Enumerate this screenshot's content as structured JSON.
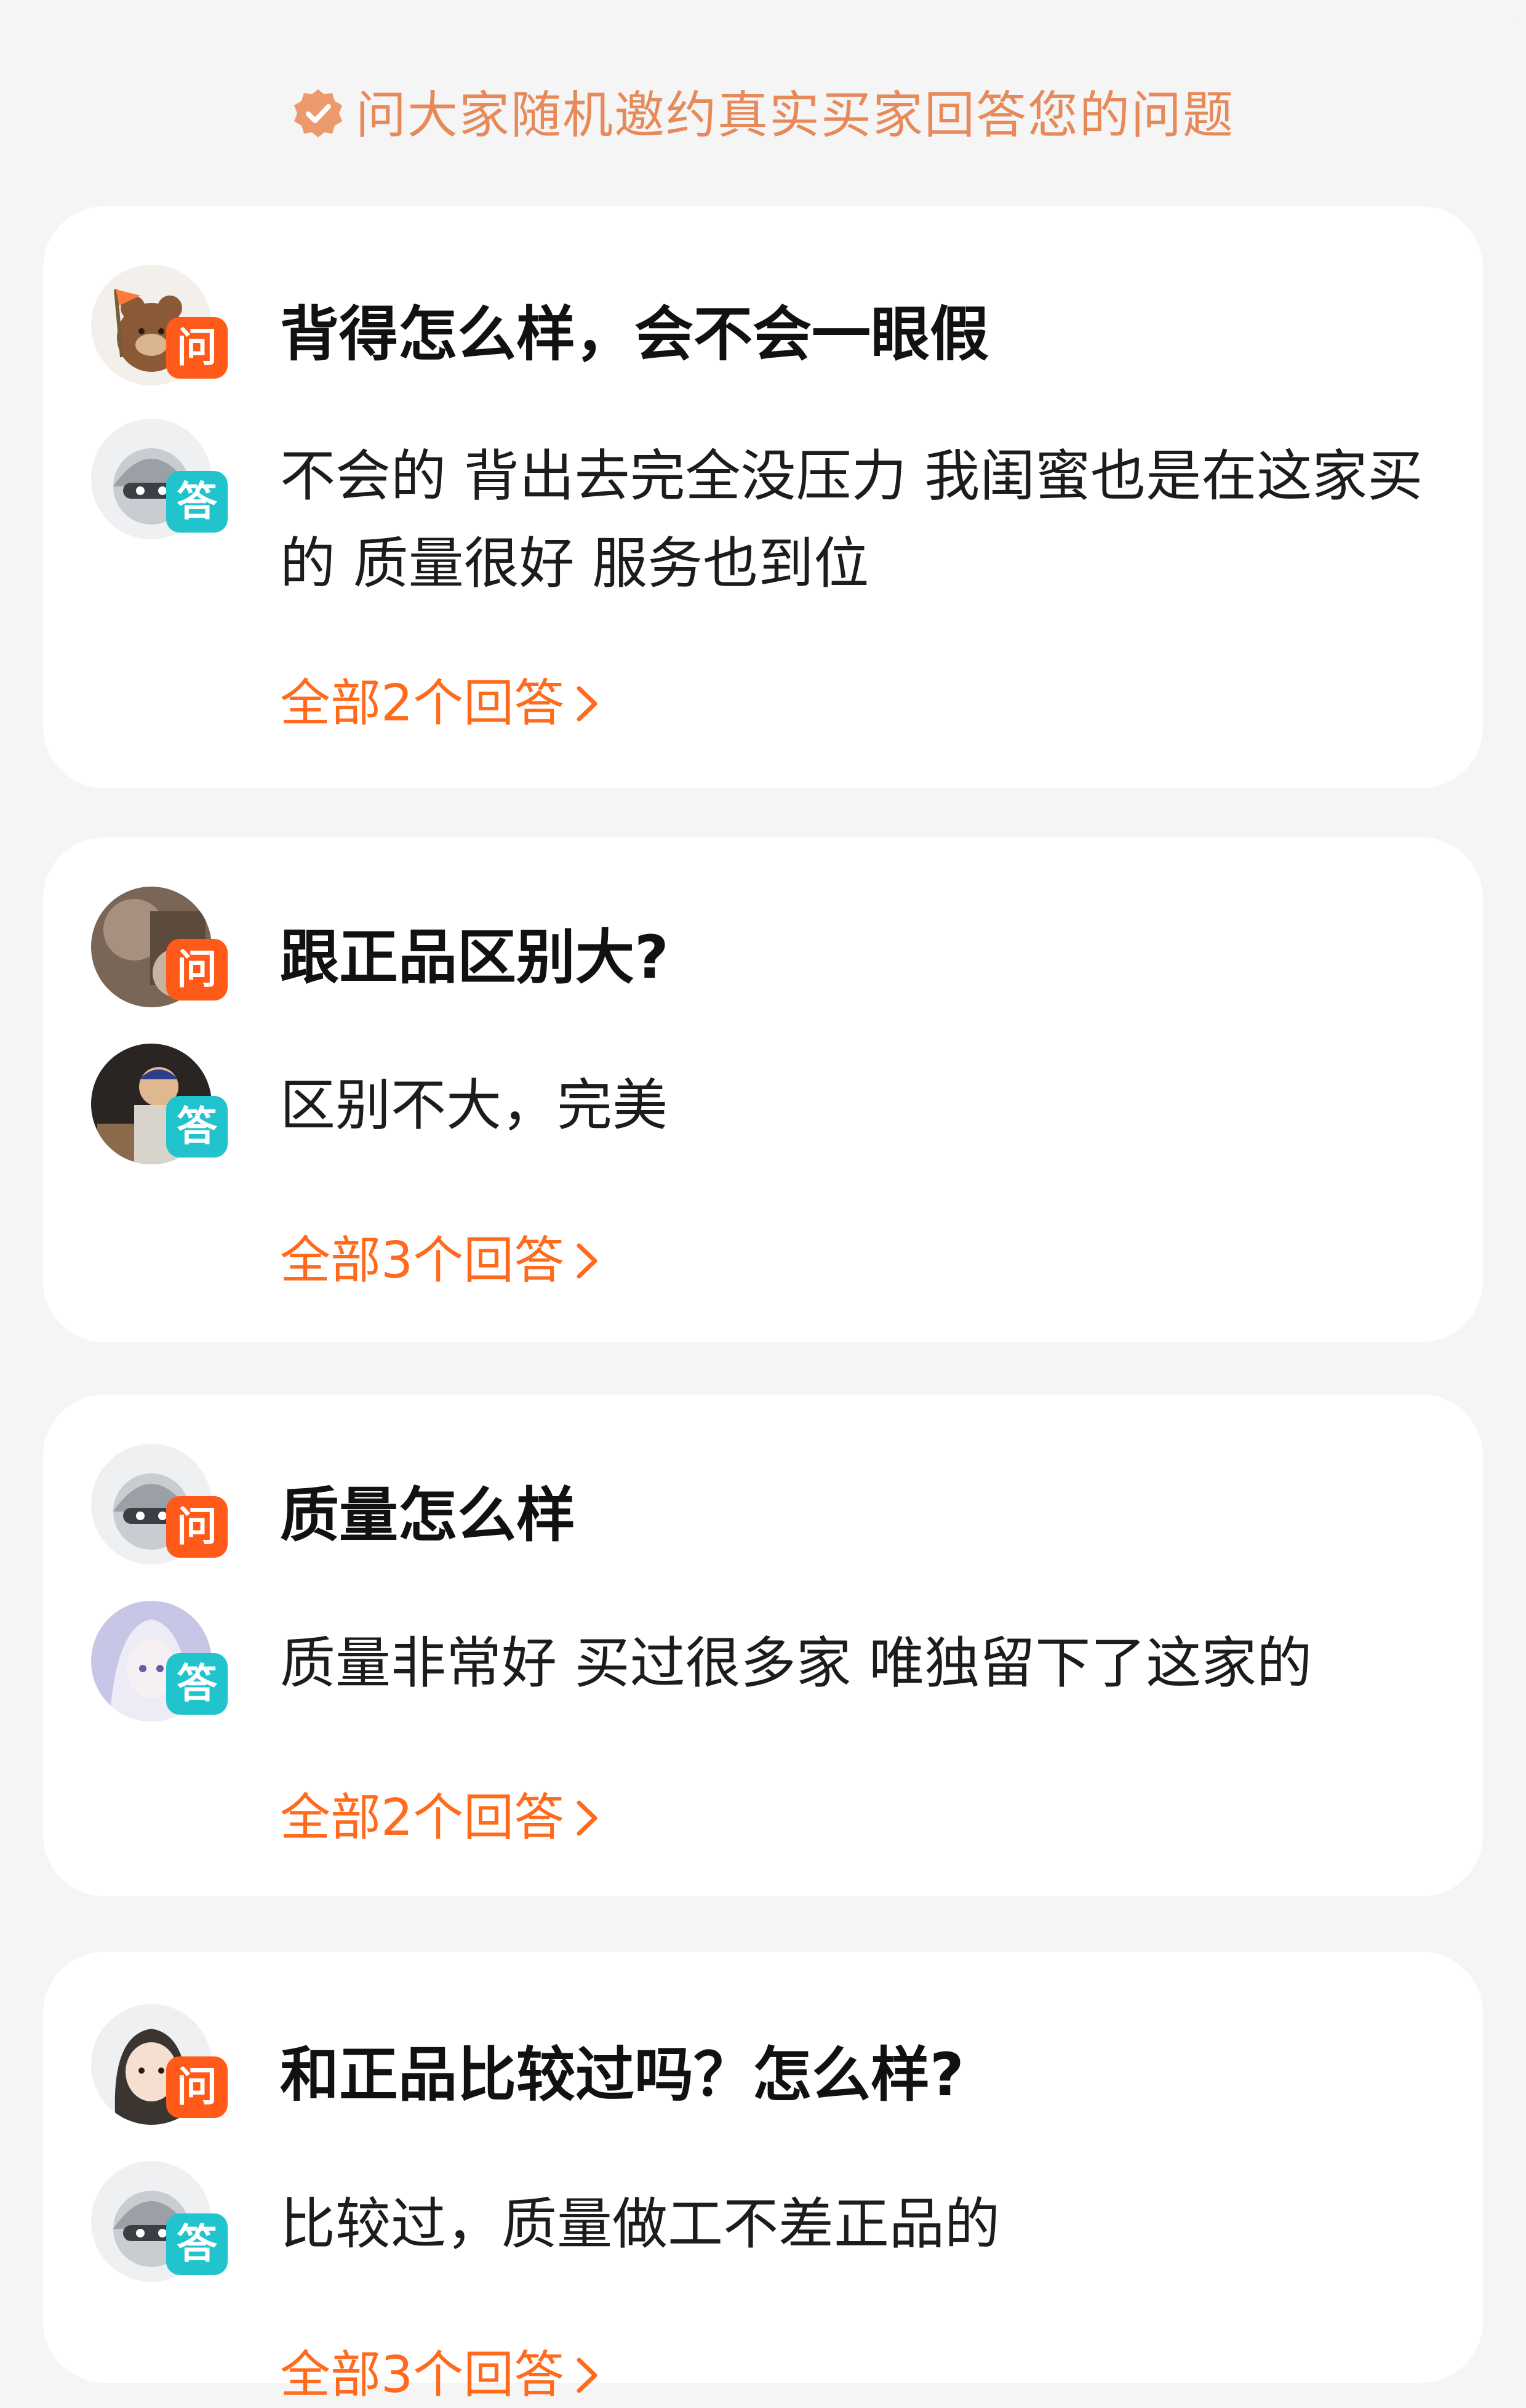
{
  "banner": {
    "text": "问大家随机邀约真实买家回答您的问题",
    "icon": "verified-badge-icon",
    "color": "#e68a5a"
  },
  "labels": {
    "question_tag": "问",
    "answer_tag": "答"
  },
  "colors": {
    "question_tag": "#ff5a19",
    "answer_tag": "#21c3cc",
    "link": "#ff6a1c"
  },
  "qa_cards": [
    {
      "question": "背得怎么样，会不会一眼假",
      "answer": "不会的 背出去完全没压力 我闺蜜也是在这家买的 质量很好 服务也到位",
      "more": "全部2个回答"
    },
    {
      "question": "跟正品区别大?",
      "answer": "区别不大，完美",
      "more": "全部3个回答"
    },
    {
      "question": "质量怎么样",
      "answer": "质量非常好 买过很多家 唯独留下了这家的",
      "more": "全部2个回答"
    },
    {
      "question": "和正品比较过吗？怎么样?",
      "answer": "比较过，质量做工不差正品的",
      "more": "全部3个回答"
    }
  ]
}
